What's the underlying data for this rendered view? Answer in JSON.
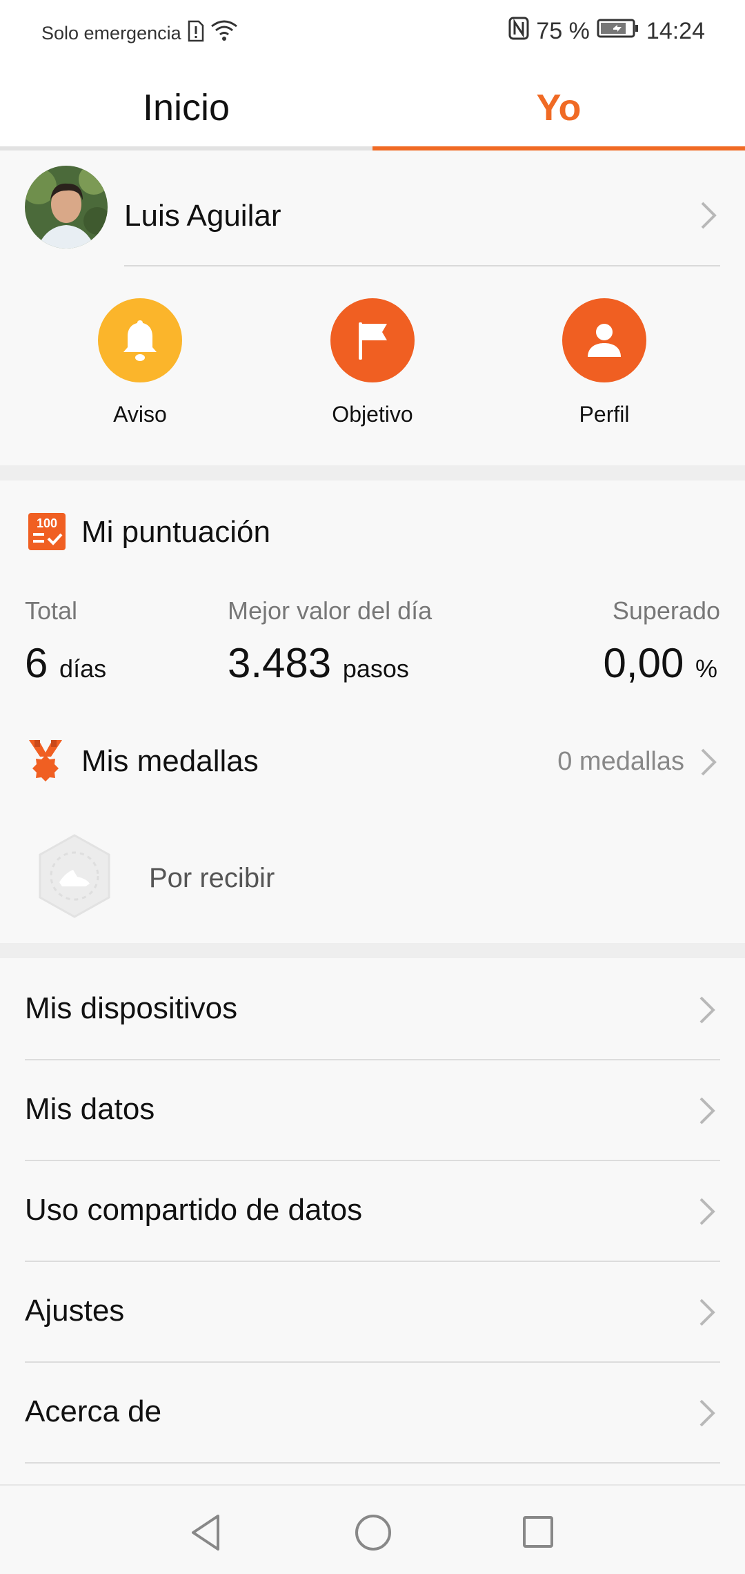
{
  "status_bar": {
    "carrier": "Solo emergencia",
    "battery": "75 %",
    "time": "14:24"
  },
  "tabs": [
    {
      "label": "Inicio"
    },
    {
      "label": "Yo"
    }
  ],
  "profile": {
    "name": "Luis Aguilar"
  },
  "quick_actions": [
    {
      "label": "Aviso",
      "icon": "bell-icon",
      "color": "#fbb52b"
    },
    {
      "label": "Objetivo",
      "icon": "flag-icon",
      "color": "#f05f22"
    },
    {
      "label": "Perfil",
      "icon": "person-icon",
      "color": "#f05f22"
    }
  ],
  "score": {
    "title": "Mi puntuación",
    "icon_text": "100",
    "stats": [
      {
        "label": "Total",
        "value": "6",
        "unit": "días"
      },
      {
        "label": "Mejor valor del día",
        "value": "3.483",
        "unit": "pasos"
      },
      {
        "label": "Superado",
        "value": "0,00",
        "unit": "%"
      }
    ]
  },
  "medals": {
    "title": "Mis medallas",
    "count": "0 medallas",
    "pending_label": "Por recibir"
  },
  "menu": [
    {
      "label": "Mis dispositivos"
    },
    {
      "label": "Mis datos"
    },
    {
      "label": "Uso compartido de datos"
    },
    {
      "label": "Ajustes"
    },
    {
      "label": "Acerca de"
    }
  ],
  "colors": {
    "accent": "#f06a24",
    "warning": "#fbb52b"
  }
}
